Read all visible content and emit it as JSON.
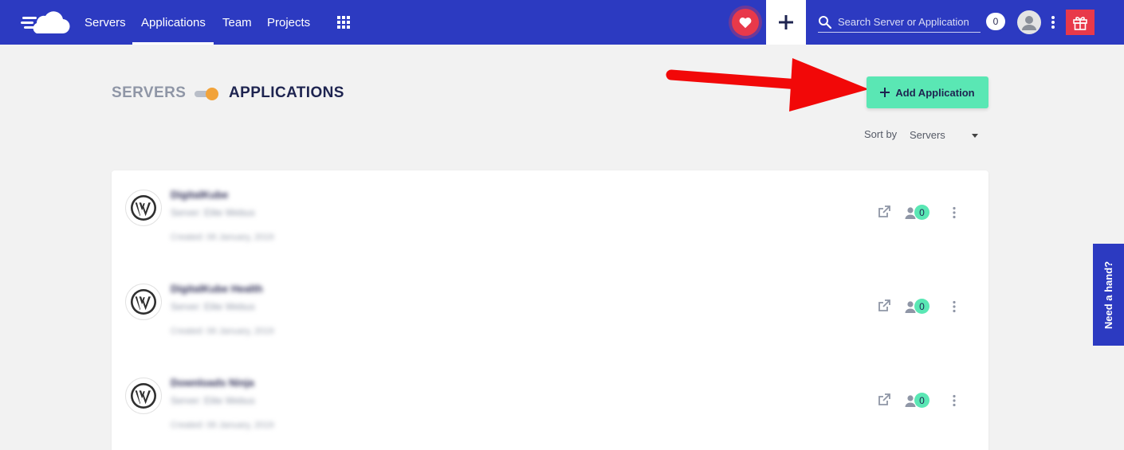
{
  "brand": {
    "logo_icon": "cloudways-cloud-icon",
    "colors": {
      "topbar": "#2c3ac1",
      "accent_green": "#5ae7b4",
      "heart_red": "#e8394a",
      "toggle_orange": "#f2a33a"
    }
  },
  "topnav": {
    "items": [
      {
        "label": "Servers",
        "active": false
      },
      {
        "label": "Applications",
        "active": true
      },
      {
        "label": "Team",
        "active": false
      },
      {
        "label": "Projects",
        "active": false
      }
    ],
    "apps_grid_icon": "grid-icon",
    "heart_icon": "heart-icon",
    "add_icon": "plus-icon",
    "search": {
      "placeholder": "Search Server or Application",
      "value": ""
    },
    "notification_count": "0",
    "avatar_icon": "user-icon",
    "menu_icon": "kebab-icon",
    "gift_icon": "gift-icon"
  },
  "toggle": {
    "left_label": "SERVERS",
    "right_label": "APPLICATIONS",
    "selected": "APPLICATIONS"
  },
  "add_button": {
    "label": "Add Application",
    "icon": "plus-icon"
  },
  "sort": {
    "label": "Sort by",
    "value": "Servers"
  },
  "applications": [
    {
      "name": "DigitalKube",
      "server": "Server: Elite Webus",
      "created": "Created: 06 January, 2019",
      "collaborators": "0"
    },
    {
      "name": "DigitalKube Health",
      "server": "Server: Elite Webus",
      "created": "Created: 06 January, 2019",
      "collaborators": "0"
    },
    {
      "name": "Downloads Ninja",
      "server": "Server: Elite Webus",
      "created": "Created: 06 January, 2019",
      "collaborators": "0"
    }
  ],
  "help_tab": {
    "label": "Need a hand?"
  }
}
